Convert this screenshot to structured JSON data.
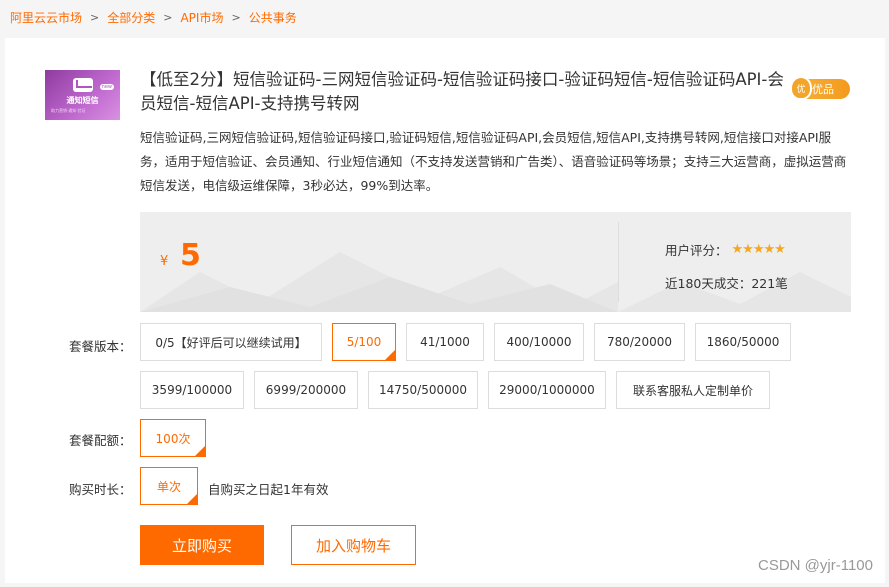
{
  "breadcrumb": {
    "items": [
      "阿里云云市场",
      "全部分类",
      "API市场",
      "公共事务"
    ],
    "separator": ">"
  },
  "product": {
    "thumbnail": {
      "title": "通知短信",
      "subtitle": "助力营销·通知·验证",
      "tag": "new"
    },
    "title": "【低至2分】短信验证码-三网短信验证码-短信验证码接口-验证码短信-短信验证码API-会员短信-短信API-支持携号转网",
    "badge": "优品",
    "badge_mark": "优",
    "description": "短信验证码,三网短信验证码,短信验证码接口,验证码短信,短信验证码API,会员短信,短信API,支持携号转网,短信接口对接API服务，适用于短信验证、会员通知、行业短信通知（不支持发送营销和广告类）、语音验证码等场景；支持三大运营商，虚拟运营商短信发送，电信级运维保障，3秒必达，99%到达率。"
  },
  "pricing": {
    "currency": "¥",
    "price": "5",
    "rating_label": "用户评分：",
    "rating_stars": "★★★★★",
    "rating_value": 5,
    "deals_text": "近180天成交：221笔"
  },
  "options": {
    "package_label": "套餐版本：",
    "packages": [
      "0/5【好评后可以继续试用】",
      "5/100",
      "41/1000",
      "400/10000",
      "780/20000",
      "1860/50000",
      "3599/100000",
      "6999/200000",
      "14750/500000",
      "29000/1000000",
      "联系客服私人定制单价"
    ],
    "selected_package": "5/100",
    "quota_label": "套餐配额：",
    "quota": "100次",
    "duration_label": "购买时长：",
    "duration": "单次",
    "validity": "自购买之日起1年有效"
  },
  "actions": {
    "buy_label": "立即购买",
    "cart_label": "加入购物车"
  },
  "watermark": "CSDN @yjr-1100",
  "colors": {
    "accent": "#ff6a00",
    "badge": "#f39a1e",
    "star": "#f5a623"
  }
}
